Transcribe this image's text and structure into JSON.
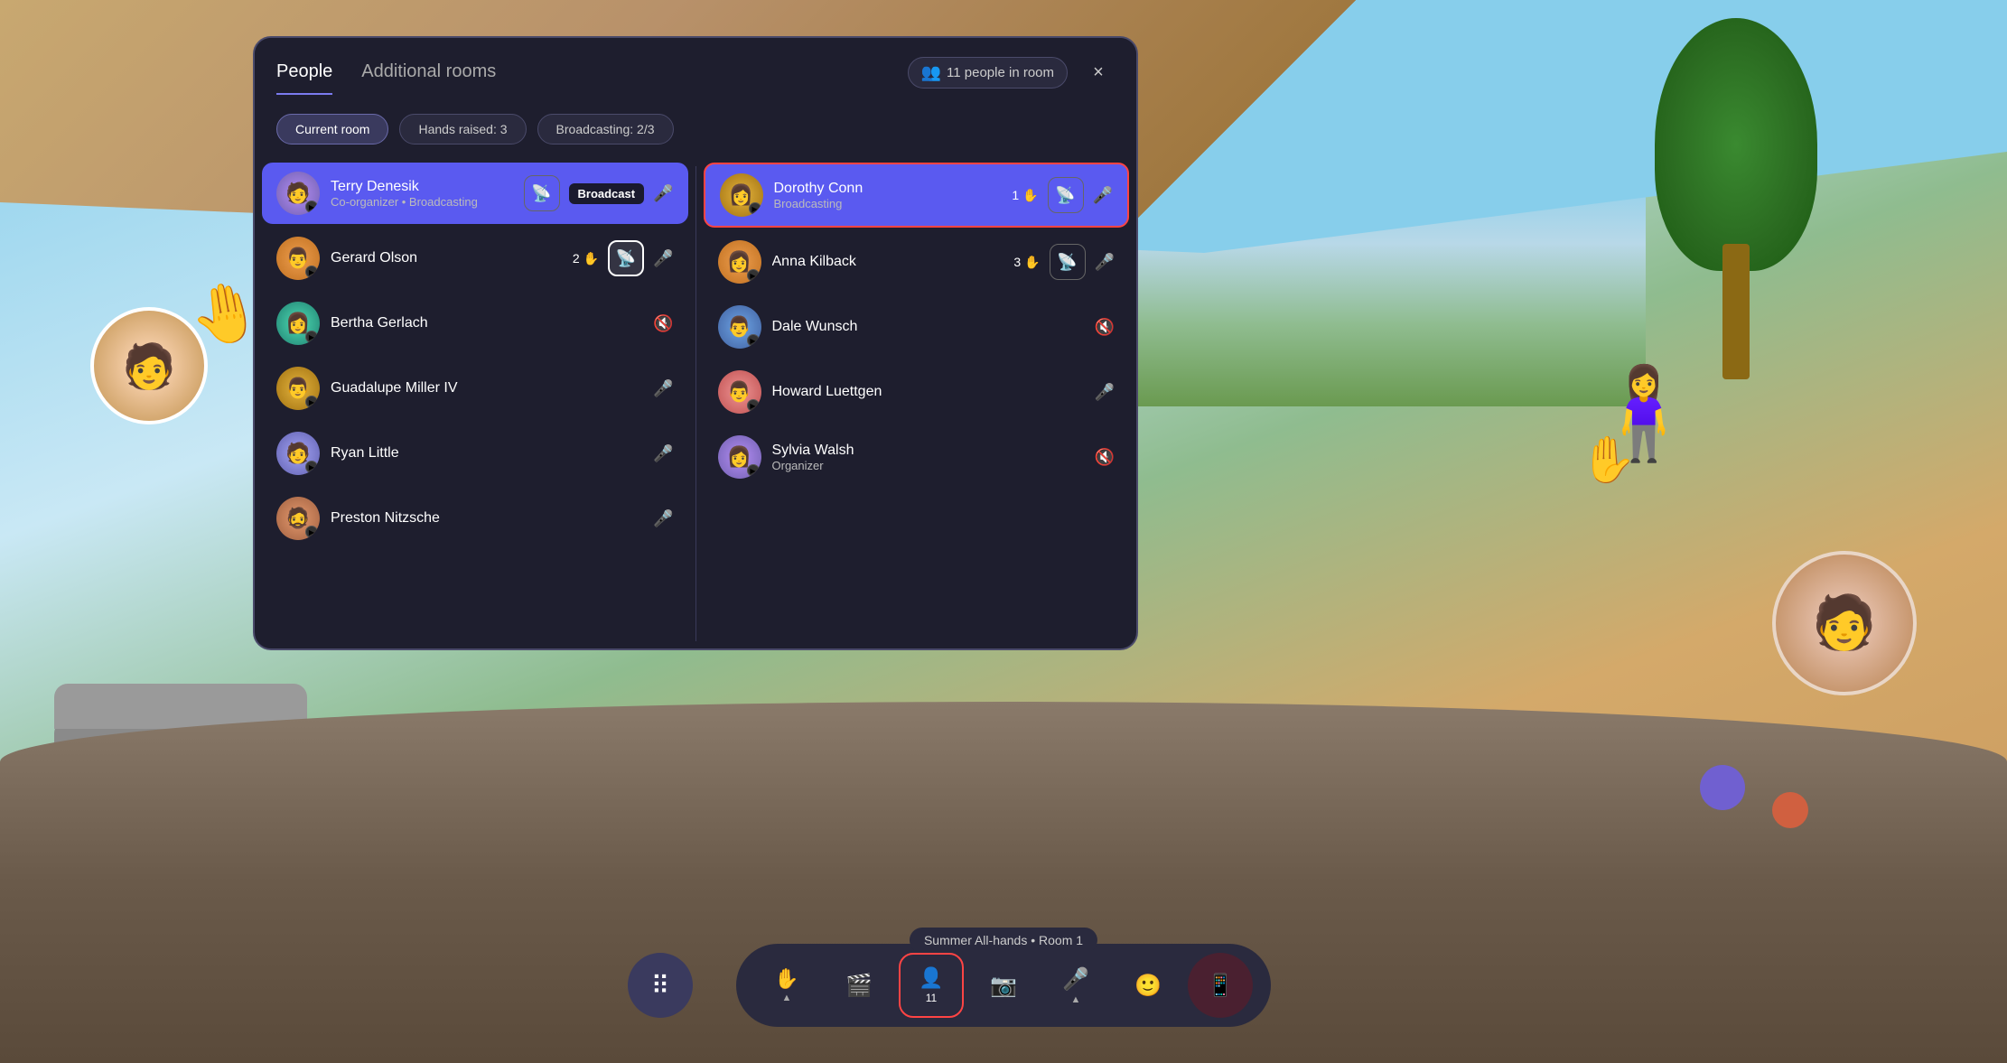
{
  "background": {
    "emoji_hand_left": "🤚",
    "emoji_hand_right": "🤚"
  },
  "panel": {
    "tabs": [
      {
        "id": "people",
        "label": "People",
        "active": true
      },
      {
        "id": "additional-rooms",
        "label": "Additional rooms",
        "active": false
      }
    ],
    "people_count": "11 people in room",
    "close_label": "×",
    "filters": [
      {
        "id": "current-room",
        "label": "Current room",
        "active": true
      },
      {
        "id": "hands-raised",
        "label": "Hands raised: 3",
        "active": false
      },
      {
        "id": "broadcasting",
        "label": "Broadcasting: 2/3",
        "active": false
      }
    ],
    "left_column": [
      {
        "id": "terry-denesik",
        "name": "Terry Denesik",
        "role": "Co-organizer • Broadcasting",
        "avatar_color": "av-purple",
        "avatar_emoji": "🧑",
        "highlighted": false,
        "broadcasting": true,
        "broadcast_badge": "Broadcast",
        "hands": 0,
        "show_cast_icon": true,
        "mic": "active"
      },
      {
        "id": "gerard-olson",
        "name": "Gerard Olson",
        "role": "",
        "avatar_color": "av-orange",
        "avatar_emoji": "👨",
        "highlighted": false,
        "broadcasting": false,
        "hands": 2,
        "show_cast_icon": true,
        "mic": "active"
      },
      {
        "id": "bertha-gerlach",
        "name": "Bertha Gerlach",
        "role": "",
        "avatar_color": "av-teal",
        "avatar_emoji": "👩",
        "highlighted": false,
        "broadcasting": false,
        "hands": 0,
        "show_cast_icon": false,
        "mic": "muted"
      },
      {
        "id": "guadalupe-miller",
        "name": "Guadalupe Miller IV",
        "role": "",
        "avatar_color": "av-gold",
        "avatar_emoji": "👨",
        "highlighted": false,
        "broadcasting": false,
        "hands": 0,
        "show_cast_icon": false,
        "mic": "active"
      },
      {
        "id": "ryan-little",
        "name": "Ryan Little",
        "role": "",
        "avatar_color": "av-lavender",
        "avatar_emoji": "🧑",
        "highlighted": false,
        "broadcasting": false,
        "hands": 0,
        "show_cast_icon": false,
        "mic": "active"
      },
      {
        "id": "preston-nitzsche",
        "name": "Preston Nitzsche",
        "role": "",
        "avatar_color": "av-warm",
        "avatar_emoji": "🧔",
        "highlighted": false,
        "broadcasting": false,
        "hands": 0,
        "show_cast_icon": false,
        "mic": "active"
      }
    ],
    "right_column": [
      {
        "id": "dorothy-conn",
        "name": "Dorothy Conn",
        "role": "Broadcasting",
        "avatar_color": "av-gold",
        "avatar_emoji": "👩",
        "highlighted": true,
        "broadcasting": true,
        "hands": 1,
        "show_cast_icon": true,
        "mic": "active"
      },
      {
        "id": "anna-kilback",
        "name": "Anna Kilback",
        "role": "",
        "avatar_color": "av-orange",
        "avatar_emoji": "👩",
        "highlighted": false,
        "broadcasting": false,
        "hands": 3,
        "show_cast_icon": true,
        "mic": "active"
      },
      {
        "id": "dale-wunsch",
        "name": "Dale Wunsch",
        "role": "",
        "avatar_color": "av-blue",
        "avatar_emoji": "👨",
        "highlighted": false,
        "broadcasting": false,
        "hands": 0,
        "show_cast_icon": false,
        "mic": "muted"
      },
      {
        "id": "howard-luettgen",
        "name": "Howard Luettgen",
        "role": "",
        "avatar_color": "av-pink",
        "avatar_emoji": "👨",
        "highlighted": false,
        "broadcasting": false,
        "hands": 0,
        "show_cast_icon": false,
        "mic": "active"
      },
      {
        "id": "sylvia-walsh",
        "name": "Sylvia Walsh",
        "role": "Organizer",
        "avatar_color": "av-purple",
        "avatar_emoji": "👩",
        "highlighted": false,
        "broadcasting": false,
        "hands": 0,
        "show_cast_icon": false,
        "mic": "muted"
      }
    ]
  },
  "toolbar": {
    "apps_label": "⠿",
    "raise_hand_label": "✋",
    "screenshare_label": "📽",
    "people_label": "11",
    "camera_label": "📷",
    "mic_label": "🎤",
    "reaction_label": "🙂",
    "end_label": "📱"
  },
  "session": {
    "label": "Summer All-hands • Room 1"
  }
}
